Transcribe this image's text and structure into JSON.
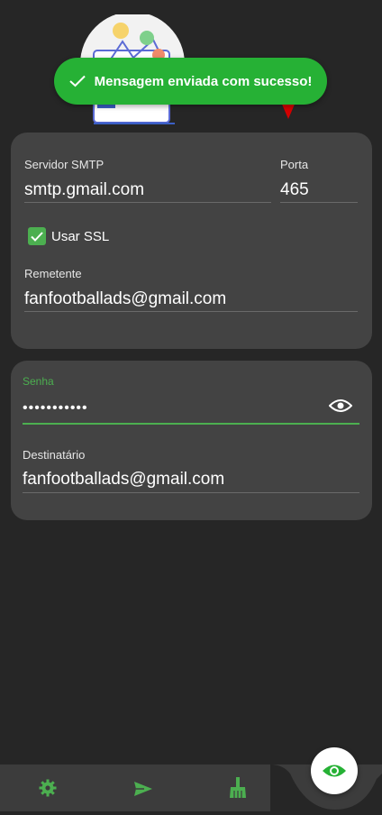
{
  "toast": {
    "message": "Mensagem enviada com sucesso!"
  },
  "smtp_card": {
    "server_label": "Servidor SMTP",
    "server_value": "smtp.gmail.com",
    "port_label": "Porta",
    "port_value": "465",
    "ssl_label": "Usar SSL",
    "ssl_checked": true,
    "sender_label": "Remetente",
    "sender_value": "fanfootballads@gmail.com"
  },
  "auth_card": {
    "password_label": "Senha",
    "password_value": "•••••••••••",
    "recipient_label": "Destinatário",
    "recipient_value": "fanfootballads@gmail.com"
  },
  "bottom_nav": {
    "items": [
      {
        "icon": "gear-icon"
      },
      {
        "icon": "send-icon"
      },
      {
        "icon": "broom-icon"
      }
    ],
    "fab_icon": "eye-icon"
  },
  "colors": {
    "accent": "#4caf50",
    "toast": "#26b135",
    "background": "#262626",
    "card": "#434343"
  }
}
